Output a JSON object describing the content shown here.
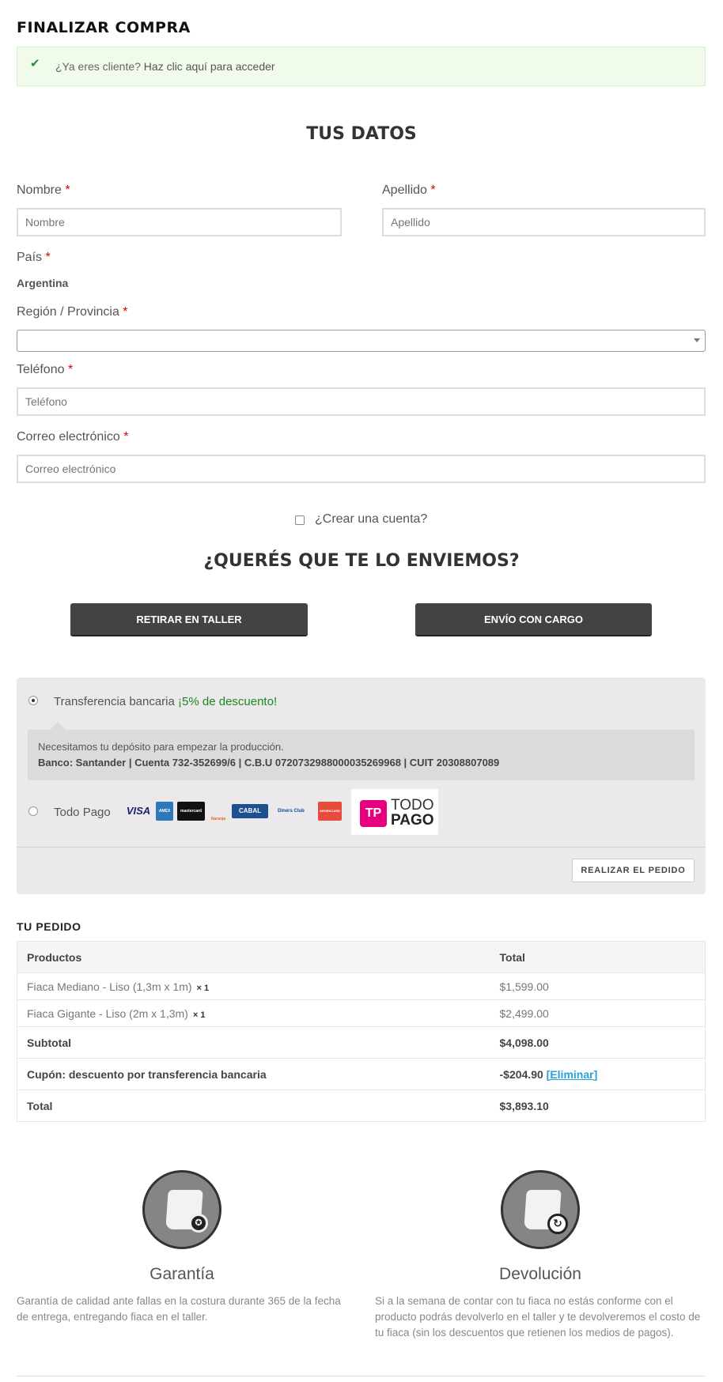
{
  "page": {
    "title": "FINALIZAR COMPRA"
  },
  "notice": {
    "text": "¿Ya eres cliente? ",
    "link": "Haz clic aquí para acceder"
  },
  "form": {
    "section_title": "TUS DATOS",
    "nombre": {
      "label": "Nombre",
      "placeholder": "Nombre"
    },
    "apellido": {
      "label": "Apellido",
      "placeholder": "Apellido"
    },
    "pais": {
      "label": "País",
      "value": "Argentina"
    },
    "region": {
      "label": "Región / Provincia",
      "value": ""
    },
    "telefono": {
      "label": "Teléfono",
      "placeholder": "Teléfono"
    },
    "email": {
      "label": "Correo electrónico",
      "placeholder": "Correo electrónico"
    },
    "required_mark": "*",
    "create_account": "¿Crear una cuenta?"
  },
  "shipping": {
    "title": "¿QUERÉS QUE TE LO ENVIEMOS?",
    "pickup_button": "RETIRAR EN TALLER",
    "delivery_button": "ENVÍO CON CARGO"
  },
  "payment": {
    "transfer": {
      "label": "Transferencia bancaria ",
      "promo": "¡5% de descuento!",
      "description": "Necesitamos tu depósito para empezar la producción.",
      "bank_details": "Banco: Santander | Cuenta 732-352699/6 | C.B.U 0720732988000035269968 | CUIT 20308807089",
      "selected": true
    },
    "todopago": {
      "label": "Todo Pago",
      "cards": [
        "VISA",
        "AMEX",
        "mastercard",
        "Naranja",
        "CABAL",
        "Diners Club",
        "ARGENCARD"
      ],
      "logo_badge": "TP",
      "logo_line1": "TODO",
      "logo_line2": "PAGO",
      "selected": false
    },
    "place_order_button": "REALIZAR EL PEDIDO"
  },
  "order": {
    "title": "TU PEDIDO",
    "headers": {
      "product": "Productos",
      "total": "Total"
    },
    "items": [
      {
        "name": "Fiaca Mediano - Liso (1,3m x 1m)",
        "qty": "× 1",
        "total": "$1,599.00"
      },
      {
        "name": "Fiaca Gigante - Liso (2m x 1,3m)",
        "qty": "× 1",
        "total": "$2,499.00"
      }
    ],
    "subtotal": {
      "label": "Subtotal",
      "value": "$4,098.00"
    },
    "coupon": {
      "label": "Cupón: descuento por transferencia bancaria",
      "value": "-$204.90",
      "remove": "[Eliminar]"
    },
    "total": {
      "label": "Total",
      "value": "$3,893.10"
    }
  },
  "features": {
    "warranty": {
      "icon": "pillow-medal-icon",
      "title": "Garantía",
      "text": "Garantía de calidad ante fallas en la costura durante 365 de la fecha de entrega, entregando fiaca en el taller."
    },
    "returns": {
      "icon": "pillow-return-icon",
      "title": "Devolución",
      "text": "Si a la semana de contar con tu fiaca no estás conforme con el producto podrás devolverlo en el taller y te devolveremos el costo de tu fiaca (sin los descuentos que retienen los medios de pagos)."
    }
  },
  "colors": {
    "accent_dark": "#434343",
    "promo_green": "#1a8a1a",
    "link_blue": "#2aa1d6",
    "required_red": "#dd0000"
  }
}
